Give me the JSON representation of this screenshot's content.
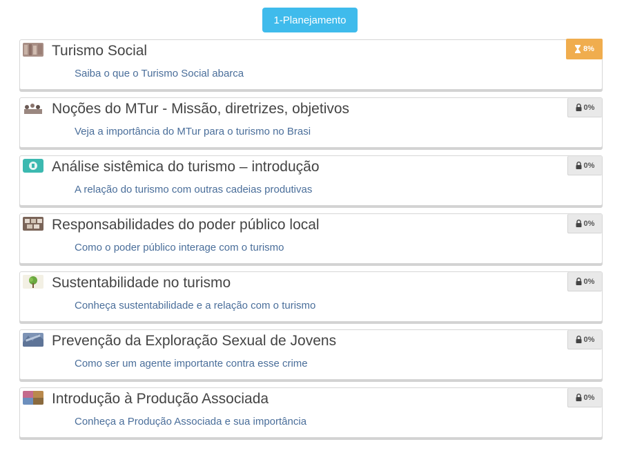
{
  "module": {
    "label": "1-Planejamento",
    "color": "#3fbbec"
  },
  "lessons": [
    {
      "title": "Turismo Social",
      "subtitle": "Saiba o que o Turismo Social abarca",
      "status": "8%",
      "status_icon": "hourglass-icon",
      "status_color": "#f0ad4e"
    },
    {
      "title": "Noções do MTur - Missão, diretrizes, objetivos",
      "subtitle": "Veja a importância do MTur para o turismo no Brasi",
      "status": "0%",
      "status_icon": "lock-icon"
    },
    {
      "title": "Análise sistêmica do turismo – introdução",
      "subtitle": "A relação do turismo com outras cadeias produtivas",
      "status": "0%",
      "status_icon": "lock-icon"
    },
    {
      "title": "Responsabilidades do poder público local",
      "subtitle": "Como o poder público interage com o turismo",
      "status": "0%",
      "status_icon": "lock-icon"
    },
    {
      "title": "Sustentabilidade no turismo",
      "subtitle": "Conheça sustentabilidade e a relação com o turismo",
      "status": "0%",
      "status_icon": "lock-icon"
    },
    {
      "title": "Prevenção da Exploração Sexual de Jovens",
      "subtitle": "Como ser um agente importante contra esse crime",
      "status": "0%",
      "status_icon": "lock-icon"
    },
    {
      "title": "Introdução à Produção Associada",
      "subtitle": "Conheça a Produção Associada e sua importância",
      "status": "0%",
      "status_icon": "lock-icon"
    }
  ]
}
